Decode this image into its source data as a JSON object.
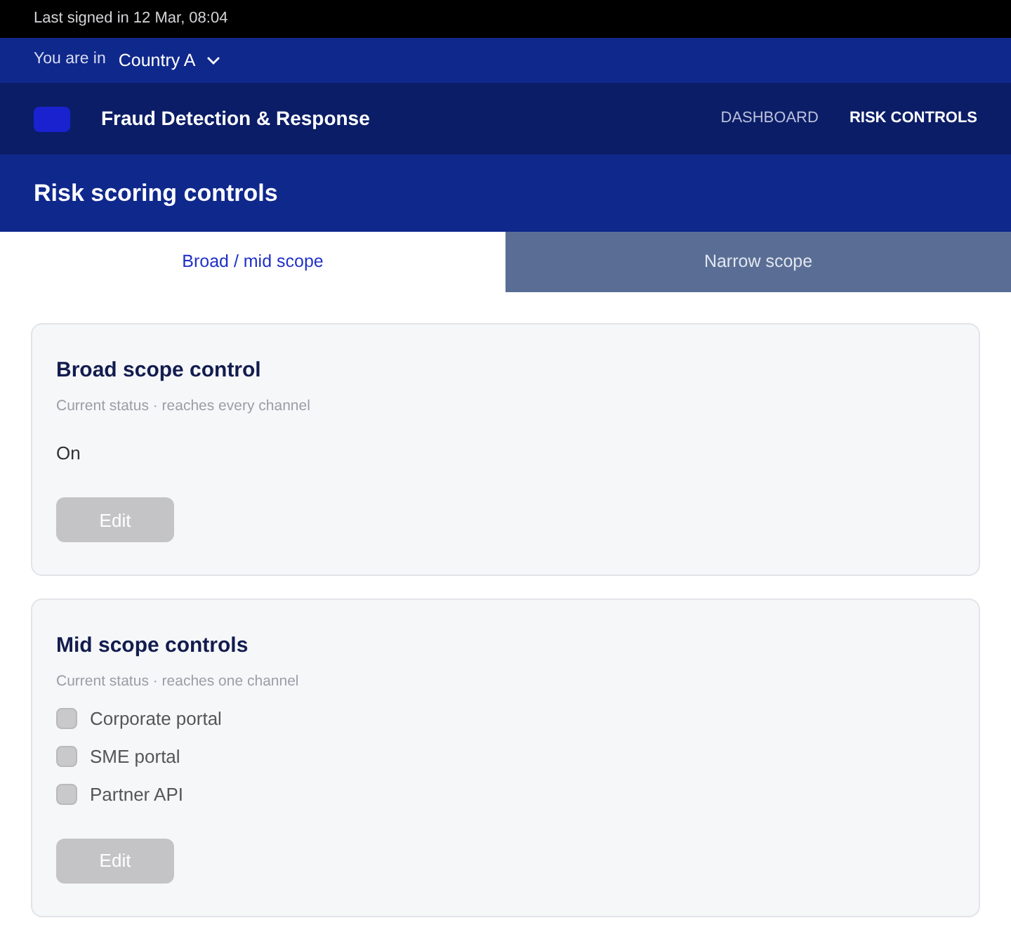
{
  "top_bar": {
    "last_signed": "Last signed in 12 Mar, 08:04"
  },
  "location": {
    "label": "You are in",
    "value": "Country A"
  },
  "header": {
    "title": "Fraud Detection & Response",
    "nav": [
      {
        "label": "DASHBOARD",
        "selected": false
      },
      {
        "label": "RISK CONTROLS",
        "selected": true
      }
    ]
  },
  "page": {
    "title": "Risk scoring controls"
  },
  "tabs": [
    {
      "label": "Broad / mid scope",
      "selected": true
    },
    {
      "label": "Narrow scope",
      "selected": false
    }
  ],
  "cards": [
    {
      "kind": "status",
      "title": "Broad scope control",
      "subtitle": "Current status · reaches every channel",
      "status": "On",
      "button": {
        "label": "Edit",
        "disabled": true
      }
    },
    {
      "kind": "checklist",
      "title": "Mid scope controls",
      "subtitle": "Current status · reaches one channel",
      "options": [
        {
          "label": "Corporate portal",
          "checked": false,
          "disabled": true
        },
        {
          "label": "SME portal",
          "checked": false,
          "disabled": true
        },
        {
          "label": "Partner API",
          "checked": false,
          "disabled": true
        }
      ],
      "button": {
        "label": "Edit",
        "disabled": true
      }
    }
  ]
}
